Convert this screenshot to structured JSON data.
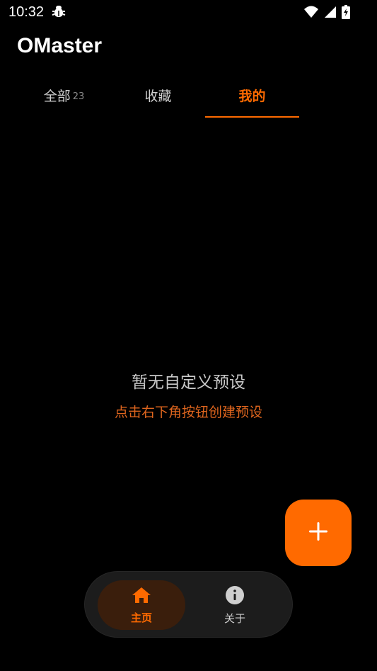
{
  "status_bar": {
    "time": "10:32",
    "icons": [
      "bug-icon",
      "wifi-icon",
      "signal-icon",
      "battery-icon"
    ]
  },
  "app": {
    "title": "OMaster"
  },
  "tabs": [
    {
      "label": "全部",
      "badge": "23",
      "active": false
    },
    {
      "label": "收藏",
      "active": false
    },
    {
      "label": "我的",
      "active": true
    }
  ],
  "empty_state": {
    "title": "暂无自定义预设",
    "hint": "点击右下角按钮创建预设"
  },
  "fab": {
    "icon": "plus-icon"
  },
  "bottom_nav": {
    "items": [
      {
        "label": "主页",
        "icon": "home-icon",
        "active": true
      },
      {
        "label": "关于",
        "icon": "info-icon",
        "active": false
      }
    ]
  },
  "colors": {
    "accent": "#ff6a00",
    "background": "#000000",
    "hint": "#e0661e"
  }
}
